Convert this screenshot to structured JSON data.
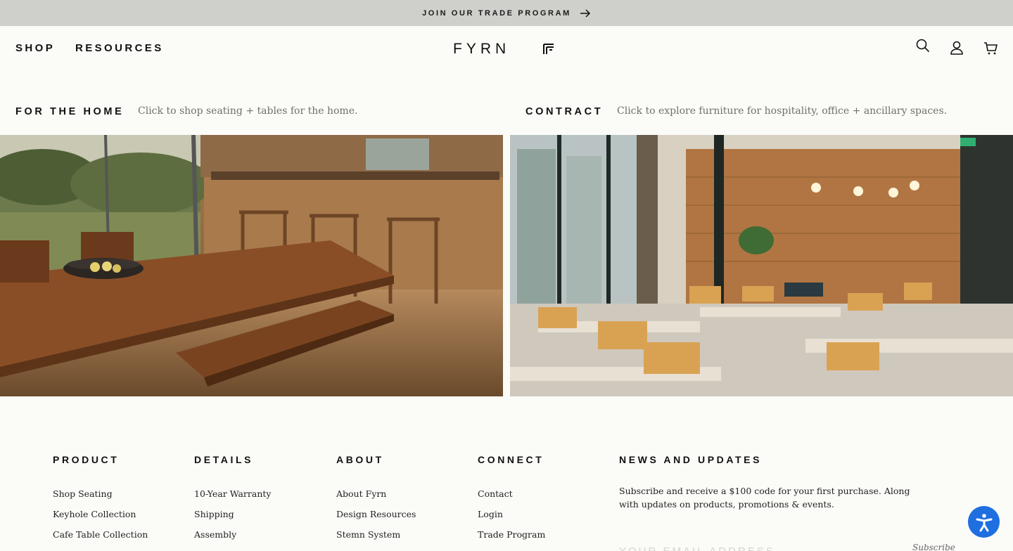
{
  "announcement": {
    "text": "JOIN OUR TRADE PROGRAM",
    "icon": "arrow-right-icon"
  },
  "header": {
    "nav": [
      "SHOP",
      "RESOURCES"
    ],
    "logo": "FYRN",
    "icons": [
      "search-icon",
      "account-icon",
      "cart-icon"
    ]
  },
  "sections": [
    {
      "title": "FOR THE HOME",
      "description": "Click to shop seating + tables for the home."
    },
    {
      "title": "CONTRACT",
      "description": "Click to explore furniture for hospitality, office + ancillary spaces."
    }
  ],
  "footer": {
    "columns": [
      {
        "heading": "PRODUCT",
        "links": [
          "Shop Seating",
          "Keyhole Collection",
          "Cafe Table Collection"
        ]
      },
      {
        "heading": "DETAILS",
        "links": [
          "10-Year Warranty",
          "Shipping",
          "Assembly"
        ]
      },
      {
        "heading": "ABOUT",
        "links": [
          "About Fyrn",
          "Design Resources",
          "Stemn System"
        ]
      },
      {
        "heading": "CONNECT",
        "links": [
          "Contact",
          "Login",
          "Trade Program"
        ]
      }
    ],
    "news": {
      "heading": "NEWS AND UPDATES",
      "copy": "Subscribe and receive a $100 code for your first purchase. Along with updates on products, promotions & events.",
      "email_placeholder": "YOUR EMAIL ADDRESS",
      "subscribe_label": "Subscribe"
    }
  },
  "accessibility": {
    "icon": "accessibility-icon"
  },
  "colors": {
    "announce_bg": "#cfcfcb",
    "page_bg": "#fbfbf8",
    "accent": "#1f6fe0"
  }
}
